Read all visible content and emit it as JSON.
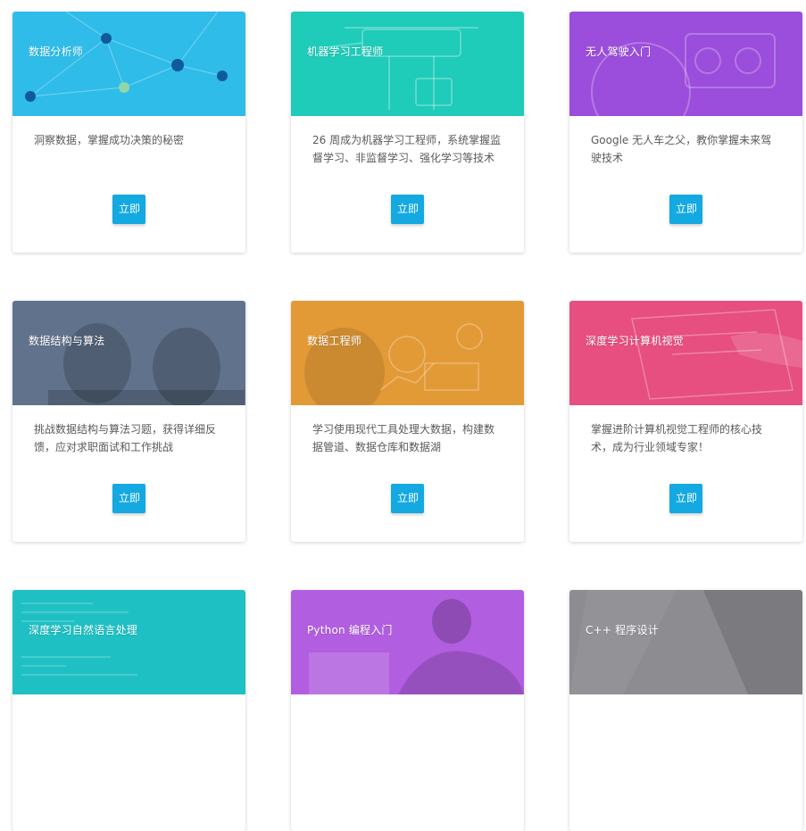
{
  "cta_label": "立即",
  "cards": [
    {
      "title": "数据分析师",
      "description": "洞察数据，掌握成功决策的秘密",
      "color": "#2fbce9"
    },
    {
      "title": "机器学习工程师",
      "description": "26 周成为机器学习工程师，系统掌握监督学习、非监督学习、强化学习等技术",
      "color": "#1fcbb9"
    },
    {
      "title": "无人驾驶入门",
      "description": "Google 无人车之父，教你掌握未来驾驶技术",
      "color": "#9b4ddb"
    },
    {
      "title": "数据结构与算法",
      "description": "挑战数据结构与算法习题，获得详细反馈，应对求职面试和工作挑战",
      "color": "#61738c"
    },
    {
      "title": "数据工程师",
      "description": "学习使用现代工具处理大数据，构建数据管道、数据仓库和数据湖",
      "color": "#e29a36"
    },
    {
      "title": "深度学习计算机视觉",
      "description": "掌握进阶计算机视觉工程师的核心技术，成为行业领域专家！",
      "color": "#e64f80"
    },
    {
      "title": "深度学习自然语言处理",
      "description": "",
      "color": "#1fc0c3"
    },
    {
      "title": "Python 编程入门",
      "description": "",
      "color": "#b15ee0"
    },
    {
      "title": "C++ 程序设计",
      "description": "",
      "color": "#8c8c91"
    }
  ]
}
